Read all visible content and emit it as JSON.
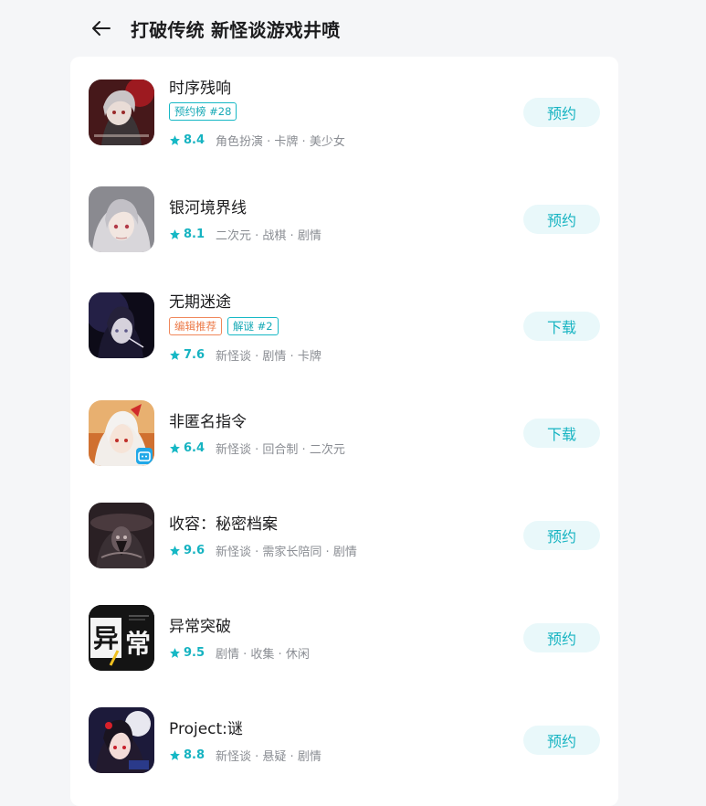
{
  "header": {
    "title": "打破传统 新怪谈游戏井喷",
    "back_icon": "arrow-left-icon"
  },
  "colors": {
    "accent": "#16b8c5",
    "editor_tag": "#ec7a48",
    "text": "#1c1c1e",
    "muted": "#8a8d93"
  },
  "games": [
    {
      "name": "时序残响",
      "tags": [
        {
          "text": "预约榜 #28",
          "style": "teal"
        }
      ],
      "rating": "8.4",
      "genres": "角色扮演 · 卡牌 · 美少女",
      "action": "预约"
    },
    {
      "name": "银河境界线",
      "tags": [],
      "rating": "8.1",
      "genres": "二次元 · 战棋 · 剧情",
      "action": "预约"
    },
    {
      "name": "无期迷途",
      "tags": [
        {
          "text": "编辑推荐",
          "style": "orange"
        },
        {
          "text": "解谜 #2",
          "style": "teal"
        }
      ],
      "rating": "7.6",
      "genres": "新怪谈 · 剧情 · 卡牌",
      "action": "下载"
    },
    {
      "name": "非匿名指令",
      "tags": [],
      "rating": "6.4",
      "genres": "新怪谈 · 回合制 · 二次元",
      "action": "下载"
    },
    {
      "name": "收容：秘密档案",
      "tags": [],
      "rating": "9.6",
      "genres": "新怪谈 · 需家长陪同 · 剧情",
      "action": "预约"
    },
    {
      "name": "异常突破",
      "tags": [],
      "rating": "9.5",
      "genres": "剧情 · 收集 · 休闲",
      "action": "预约",
      "icon_text": [
        "异",
        "常"
      ]
    },
    {
      "name": "Project:谜",
      "tags": [],
      "rating": "8.8",
      "genres": "新怪谈 · 悬疑 · 剧情",
      "action": "预约"
    }
  ]
}
